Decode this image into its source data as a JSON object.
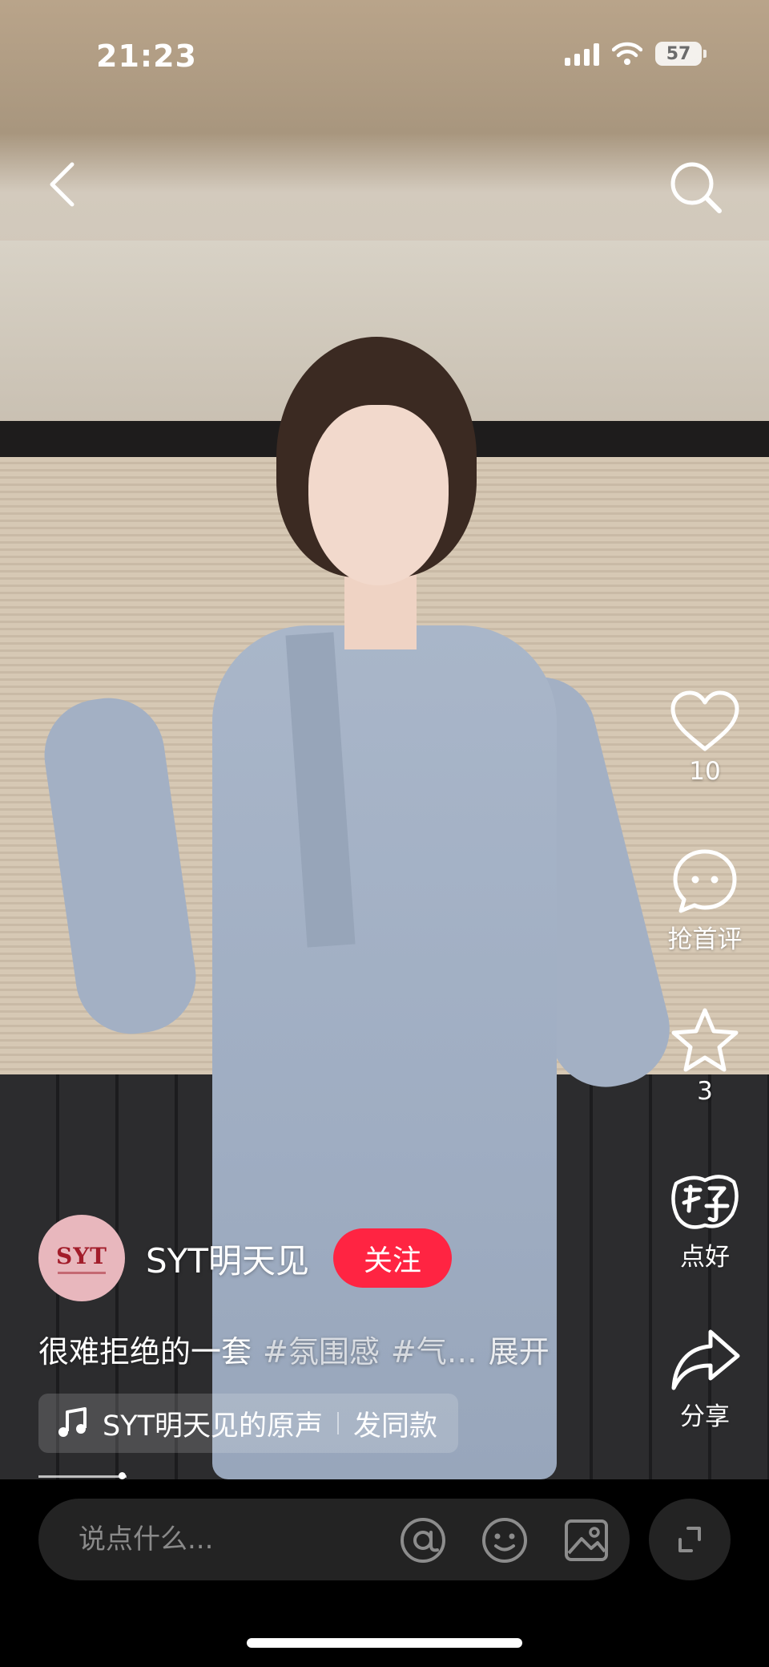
{
  "status_bar": {
    "time": "21:23",
    "battery": "57"
  },
  "nav": {
    "back_icon": "chevron-left-icon",
    "search_icon": "search-icon"
  },
  "actions": {
    "like": {
      "count": "10",
      "icon": "heart-icon"
    },
    "comment": {
      "label": "抢首评",
      "icon": "comment-bubble-icon"
    },
    "collect": {
      "count": "3",
      "icon": "star-icon"
    },
    "good": {
      "label": "点好",
      "icon": "hao-badge-icon"
    },
    "share": {
      "label": "分享",
      "icon": "share-arrow-icon"
    }
  },
  "author": {
    "avatar_text": "SYT",
    "name": "SYT明天见",
    "follow_label": "关注"
  },
  "caption": {
    "text": "很难拒绝的一套",
    "tags": [
      "#氛围感",
      "#气…"
    ],
    "more": "展开"
  },
  "music": {
    "source": "SYT明天见的原声",
    "action": "发同款",
    "icon": "music-note-icon"
  },
  "comment_bar": {
    "placeholder": "说点什么...",
    "icons": [
      "at-icon",
      "emoji-icon",
      "image-icon",
      "expand-icon"
    ]
  },
  "colors": {
    "accent": "#ff2442",
    "bar_bg": "#232323"
  }
}
